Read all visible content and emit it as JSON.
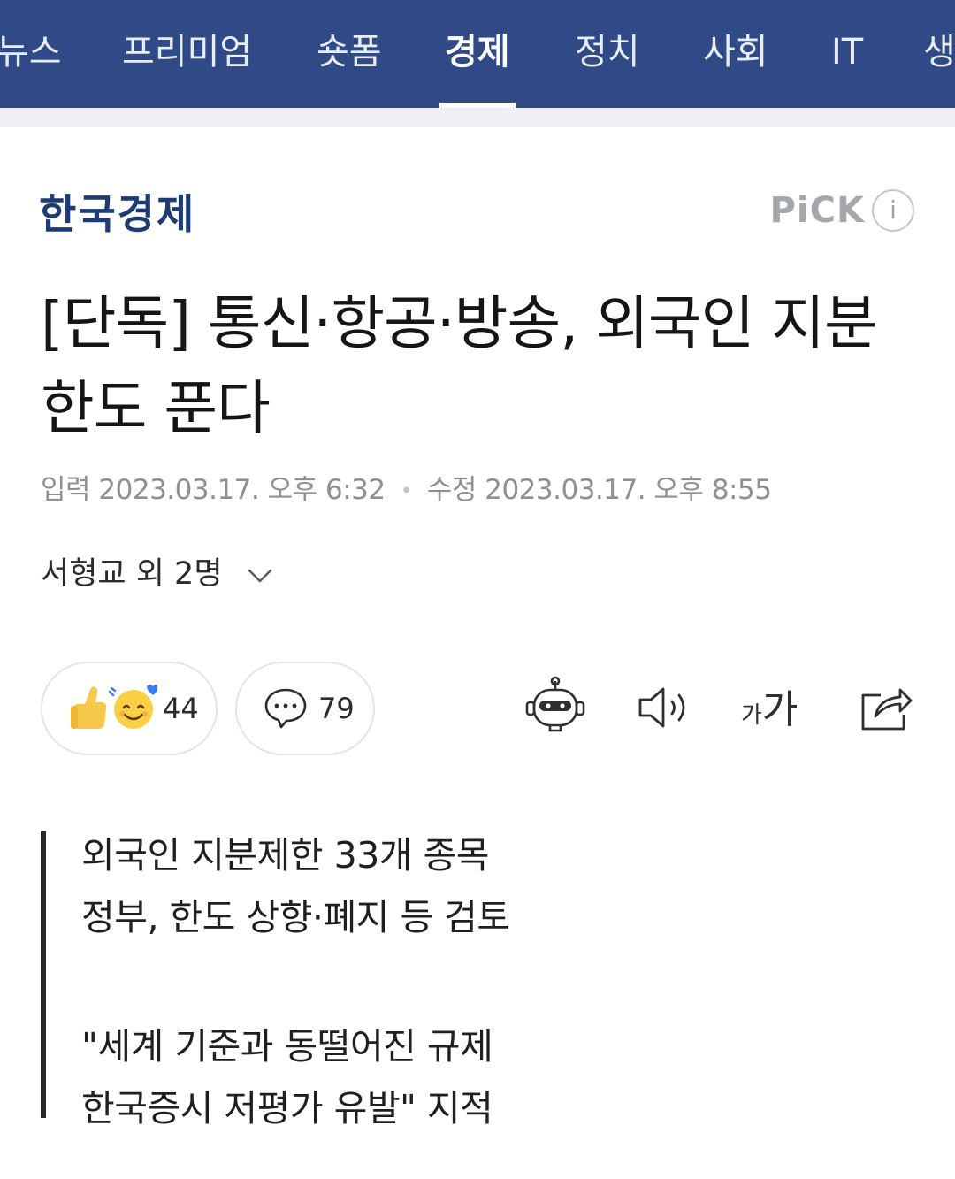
{
  "nav": {
    "tabs": [
      "뉴스",
      "프리미엄",
      "숏폼",
      "경제",
      "정치",
      "사회",
      "IT",
      "생"
    ],
    "active": "경제"
  },
  "press": {
    "name": "한국경제",
    "pick_label": "PiCK",
    "info_icon": "i"
  },
  "article": {
    "title_line1": "[단독] 통신·항공·방송, 외국인 지분",
    "title_line2": "한도 푼다",
    "input_label": "입력",
    "input_time": "2023.03.17. 오후 6:32",
    "edit_label": "수정",
    "edit_time": "2023.03.17. 오후 8:55",
    "reporter": "서형교 외 2명"
  },
  "actions": {
    "reaction_count": "44",
    "comment_count": "79",
    "font_small": "가",
    "font_big": "가"
  },
  "summary": {
    "line1": "외국인 지분제한 33개 종목",
    "line2": "정부, 한도 상향·폐지 등 검토",
    "line3": "\"세계 기준과 동떨어진 규제",
    "line4": "한국증시 저평가 유발\" 지적"
  },
  "colors": {
    "nav_bg": "#2f4a86",
    "logo": "#1f3b76",
    "pick": "#a4a8ad",
    "meta": "#8d9095"
  },
  "icons": {
    "reaction": "thumbs-up-smile-icon",
    "comment": "speech-bubble-icon",
    "summary_bot": "robot-icon",
    "tts": "speaker-icon",
    "font": "font-size-icon",
    "share": "share-icon",
    "reporter_toggle": "chevron-down-icon"
  }
}
